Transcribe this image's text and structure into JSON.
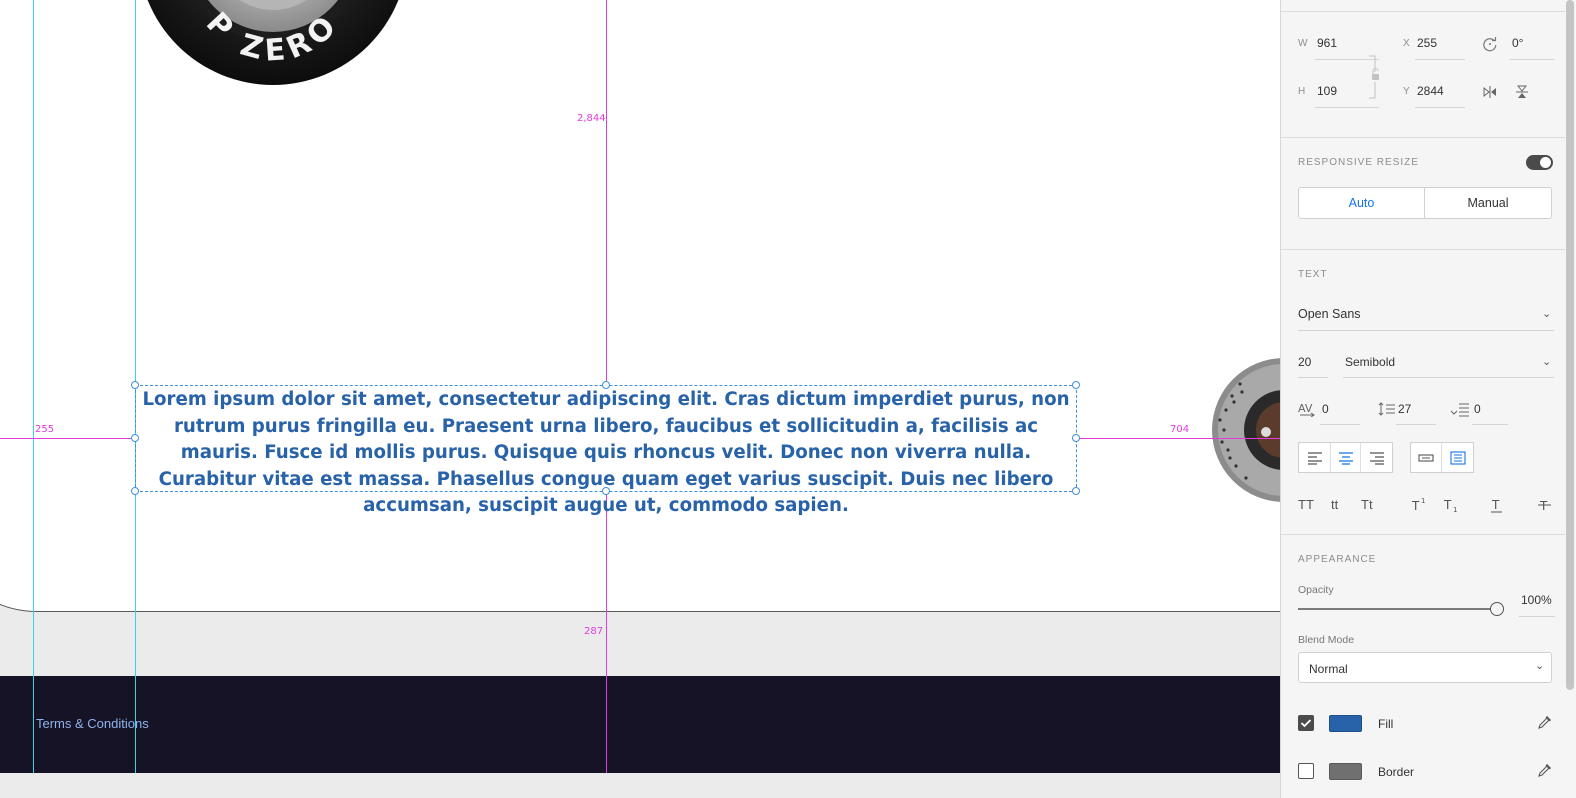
{
  "canvas": {
    "body_text": "Lorem ipsum dolor sit amet, consectetur adipiscing elit. Cras dictum imperdiet purus, non rutrum purus fringilla eu. Praesent urna libero, faucibus et sollicitudin a, facilisis ac mauris. Fusce id mollis purus. Quisque quis rhoncus velit. Donec non viverra nulla. Curabitur vitae est massa. Phasellus congue quam eget varius suscipit. Duis nec libero accumsan, suscipit augue ut, commodo sapien.",
    "footer_link": "Terms & Conditions",
    "measurements": {
      "top": "2,844",
      "left": "255",
      "right": "704",
      "bottom": "287"
    },
    "tire_lettering": "P ZERO"
  },
  "panel": {
    "transform": {
      "w_label": "W",
      "w_value": "961",
      "h_label": "H",
      "h_value": "109",
      "x_label": "X",
      "x_value": "255",
      "y_label": "Y",
      "y_value": "2844",
      "rotation_value": "0°"
    },
    "responsive_resize": {
      "title": "RESPONSIVE RESIZE",
      "enabled": true,
      "auto_label": "Auto",
      "manual_label": "Manual",
      "selected": "Auto"
    },
    "text": {
      "title": "TEXT",
      "font_family": "Open Sans",
      "font_size": "20",
      "font_weight": "Semibold",
      "char_spacing": "0",
      "line_spacing": "27",
      "paragraph_spacing": "0",
      "alignment": "center",
      "case_labels": [
        "TT",
        "tt",
        "Tt"
      ]
    },
    "appearance": {
      "title": "APPEARANCE",
      "opacity_label": "Opacity",
      "opacity_value": "100%",
      "opacity_level": 1.0,
      "blend_mode_label": "Blend Mode",
      "blend_mode_value": "Normal",
      "fill_label": "Fill",
      "fill_checked": true,
      "fill_color": "#2862a8",
      "border_label": "Border",
      "border_checked": false,
      "border_color": "#707070"
    }
  },
  "colors": {
    "accent": "#1473e6",
    "guide_cyan": "#34d6e4",
    "guide_magenta": "#e23ce0",
    "footer_bg": "#161327",
    "text_blue": "#2862a8"
  }
}
